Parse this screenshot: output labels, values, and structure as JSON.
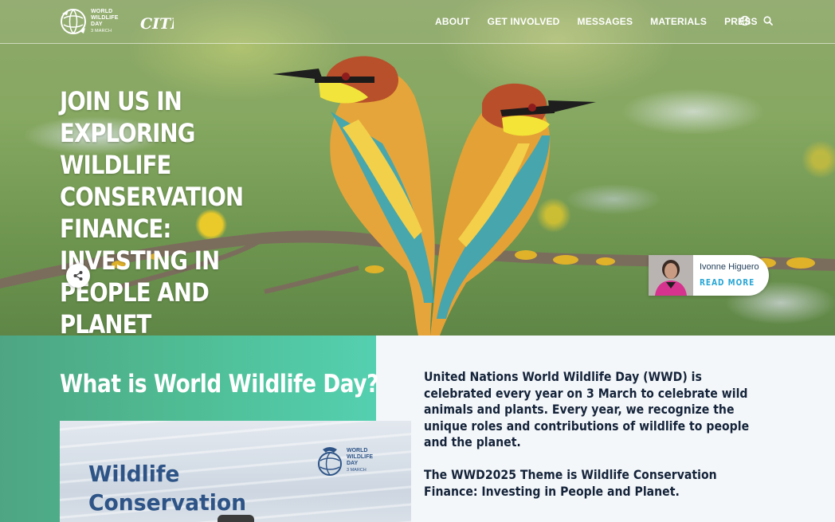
{
  "nav": {
    "logo_title": "WORLD WILDLIFE DAY",
    "logo_date": "3 MARCH",
    "partner_logo": "CITES",
    "items": [
      {
        "label": "ABOUT"
      },
      {
        "label": "GET INVOLVED"
      },
      {
        "label": "MESSAGES"
      },
      {
        "label": "MATERIALS"
      },
      {
        "label": "PRESS"
      }
    ],
    "icons": [
      "globe-icon",
      "search-icon"
    ]
  },
  "hero": {
    "title": "JOIN US IN EXPLORING WILDLIFE CONSERVATION FINANCE: INVESTING IN PEOPLE AND PLANET",
    "share_icon": "share-icon",
    "card": {
      "name": "Ivonne Higuero",
      "cta": "READ MORE"
    }
  },
  "about": {
    "heading": "What is World Wildlife Day?",
    "video": {
      "title": "Wildlife Conservation Finance",
      "logo_title": "WORLD WILDLIFE DAY",
      "logo_date": "3 MARCH"
    },
    "paragraph_1": "United Nations World Wildlife Day (WWD) is celebrated every year on 3 March to celebrate wild animals and plants. Every year, we recognize the unique roles and contributions of wildlife to people and the planet.",
    "paragraph_2": "The WWD2025 Theme is Wildlife Conservation Finance: Investing in People and Planet."
  },
  "colors": {
    "accent_green": "#4fbd95",
    "link_blue": "#29a7d6",
    "text_dark": "#14233a"
  }
}
